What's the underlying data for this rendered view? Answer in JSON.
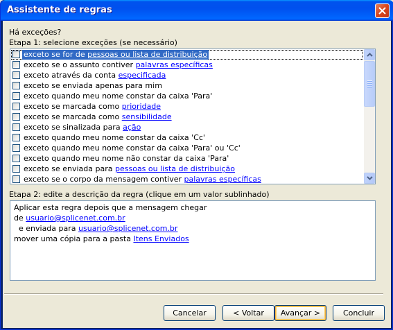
{
  "window": {
    "title": "Assistente de regras"
  },
  "question": "Há exceções?",
  "step1": {
    "label": "Etapa 1: selecione exceções (se necessário)",
    "items": [
      {
        "text": "exceto se for de ",
        "link": "pessoas ou lista de distribuição",
        "checked": false,
        "selected": true
      },
      {
        "text": "exceto se o assunto contiver ",
        "link": "palavras específicas",
        "checked": false
      },
      {
        "text": "exceto através da conta ",
        "link": "especificada",
        "checked": false
      },
      {
        "text": "exceto se enviada apenas para mim",
        "link": "",
        "checked": false
      },
      {
        "text": "exceto quando meu nome constar da caixa 'Para'",
        "link": "",
        "checked": false
      },
      {
        "text": "exceto se marcada como ",
        "link": "prioridade",
        "checked": false
      },
      {
        "text": "exceto se marcada como ",
        "link": "sensibilidade",
        "checked": false
      },
      {
        "text": "exceto se sinalizada para ",
        "link": "ação",
        "checked": false
      },
      {
        "text": "exceto quando meu nome constar da caixa 'Cc'",
        "link": "",
        "checked": false
      },
      {
        "text": "exceto quando meu nome constar da caixa 'Para' ou 'Cc'",
        "link": "",
        "checked": false
      },
      {
        "text": "exceto quando meu nome não constar da caixa 'Para'",
        "link": "",
        "checked": false
      },
      {
        "text": "exceto se enviada para ",
        "link": "pessoas ou lista de distribuição",
        "checked": false
      },
      {
        "text": "exceto se o corpo da mensagem contiver ",
        "link": "palavras específicas",
        "checked": false
      }
    ]
  },
  "step2": {
    "label": "Etapa 2: edite a descrição da regra (clique em um valor sublinhado)",
    "lines": [
      {
        "text": "Aplicar esta regra depois que a mensagem chegar",
        "link": ""
      },
      {
        "text": "de ",
        "link": "usuario@splicenet.com.br"
      },
      {
        "text": "  e enviada para ",
        "link": "usuario@splicenet.com.br"
      },
      {
        "text": "mover uma cópia para a pasta ",
        "link": "Itens Enviados"
      }
    ]
  },
  "buttons": {
    "cancel": "Cancelar",
    "back": "< Voltar",
    "next": "Avançar >",
    "finish": "Concluir"
  },
  "colors": {
    "selection": "#316ac5",
    "link": "#0000ff",
    "dialog_bg": "#ece9d8"
  }
}
